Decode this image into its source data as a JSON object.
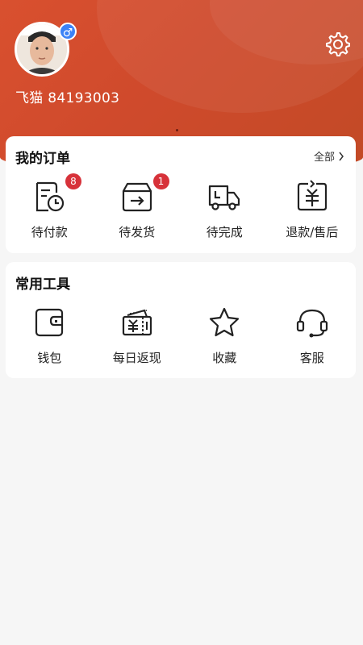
{
  "profile": {
    "username": "飞猫 84193003",
    "gender_symbol": "♂"
  },
  "orders": {
    "title": "我的订单",
    "view_all_label": "全部",
    "items": [
      {
        "label": "待付款",
        "badge": "8",
        "icon": "pending-payment-icon"
      },
      {
        "label": "待发货",
        "badge": "1",
        "icon": "pending-shipment-icon"
      },
      {
        "label": "待完成",
        "icon": "delivery-truck-icon"
      },
      {
        "label": "退款/售后",
        "icon": "refund-icon"
      }
    ]
  },
  "tools": {
    "title": "常用工具",
    "items": [
      {
        "label": "钱包",
        "icon": "wallet-icon"
      },
      {
        "label": "每日返现",
        "icon": "cashback-icon"
      },
      {
        "label": "收藏",
        "icon": "star-icon"
      },
      {
        "label": "客服",
        "icon": "headset-icon"
      }
    ]
  },
  "colors": {
    "header": "#d9502f",
    "badge": "#d7323a",
    "gender_badge": "#3b82f6"
  }
}
